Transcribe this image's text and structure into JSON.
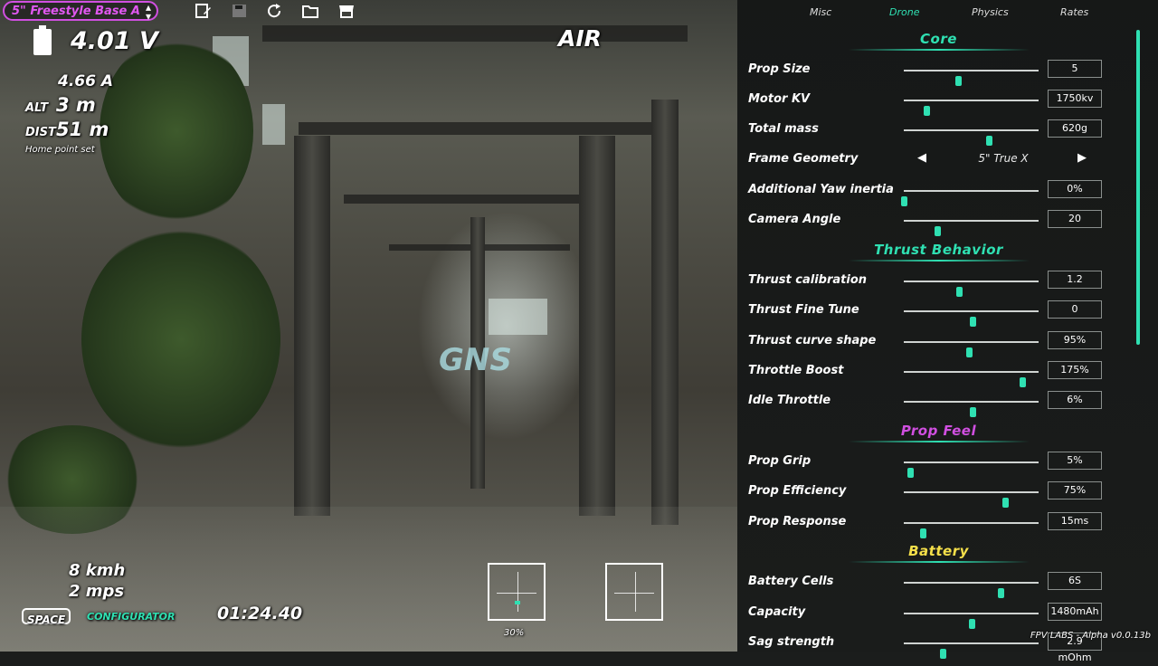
{
  "profile": {
    "name": "5\" Freestyle Base A"
  },
  "toolbar": {
    "icons": [
      "edit-icon",
      "save-icon",
      "reload-icon",
      "folder-icon",
      "store-icon"
    ]
  },
  "osd": {
    "voltage": "4.01 V",
    "current": "4.66 A",
    "alt_label": "ALT",
    "alt_value": "3 m",
    "dist_label": "DIST",
    "dist_value": "51 m",
    "home_status": "Home point set",
    "mode": "AIR",
    "speed_kmh": "8 kmh",
    "speed_mps": "2 mps",
    "space_key": "SPACE",
    "configurator": "CONFIGURATOR",
    "timer": "01:24.40",
    "throttle_pct": "30%"
  },
  "tabs": [
    {
      "label": "Misc",
      "active": false
    },
    {
      "label": "Drone",
      "active": true
    },
    {
      "label": "Physics",
      "active": false
    },
    {
      "label": "Rates",
      "active": false
    }
  ],
  "sections": {
    "core": {
      "title": "Core",
      "color": "#2fe0b2"
    },
    "thrust": {
      "title": "Thrust Behavior",
      "color": "#2fe0b2"
    },
    "prop": {
      "title": "Prop Feel",
      "color": "#d04fe0"
    },
    "battery": {
      "title": "Battery",
      "color": "#f5e04a"
    }
  },
  "settings": {
    "prop_size": {
      "label": "Prop Size",
      "value": "5",
      "fill": 0.4
    },
    "motor_kv": {
      "label": "Motor KV",
      "value": "1750kv",
      "fill": 0.17
    },
    "total_mass": {
      "label": "Total mass",
      "value": "620g",
      "fill": 0.63
    },
    "frame_geometry": {
      "label": "Frame Geometry",
      "value": "5\" True X"
    },
    "yaw_inertia": {
      "label": "Additional Yaw inertia",
      "value": "0%",
      "fill": 0.0
    },
    "camera_angle": {
      "label": "Camera Angle",
      "value": "20",
      "fill": 0.25
    },
    "thrust_calibration": {
      "label": "Thrust calibration",
      "value": "1.2",
      "fill": 0.41
    },
    "thrust_fine_tune": {
      "label": "Thrust Fine Tune",
      "value": "0",
      "fill": 0.51
    },
    "thrust_curve_shape": {
      "label": "Thrust curve shape",
      "value": "95%",
      "fill": 0.48
    },
    "throttle_boost": {
      "label": "Throttle Boost",
      "value": "175%",
      "fill": 0.88
    },
    "idle_throttle": {
      "label": "Idle Throttle",
      "value": "6%",
      "fill": 0.51
    },
    "prop_grip": {
      "label": "Prop Grip",
      "value": "5%",
      "fill": 0.05
    },
    "prop_efficiency": {
      "label": "Prop Efficiency",
      "value": "75%",
      "fill": 0.75
    },
    "prop_response": {
      "label": "Prop Response",
      "value": "15ms",
      "fill": 0.14
    },
    "battery_cells": {
      "label": "Battery Cells",
      "value": "6S",
      "fill": 0.72
    },
    "capacity": {
      "label": "Capacity",
      "value": "1480mAh",
      "fill": 0.5
    },
    "sag_strength": {
      "label": "Sag strength",
      "value": "2.9 mOhm",
      "fill": 0.29
    }
  },
  "version": "FPV LABS - Alpha v0.0.13b",
  "colors": {
    "accent": "#2fe0b2",
    "profile": "#e057f0",
    "battery": "#f5e04a"
  }
}
